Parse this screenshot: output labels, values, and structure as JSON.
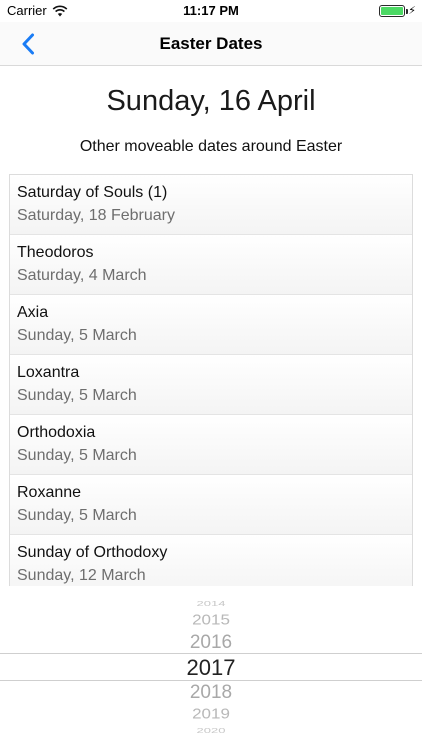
{
  "status_bar": {
    "carrier": "Carrier",
    "time": "11:17 PM"
  },
  "nav": {
    "title": "Easter Dates",
    "back_icon": "chevron-left-icon"
  },
  "header": {
    "easter_date": "Sunday, 16 April",
    "subtitle": "Other moveable dates around Easter"
  },
  "dates": [
    {
      "name": "Saturday of Souls (1)",
      "date": "Saturday, 18 February"
    },
    {
      "name": "Theodoros",
      "date": "Saturday, 4 March"
    },
    {
      "name": "Axia",
      "date": "Sunday, 5 March"
    },
    {
      "name": "Loxantra",
      "date": "Sunday, 5 March"
    },
    {
      "name": "Orthodoxia",
      "date": "Sunday, 5 March"
    },
    {
      "name": "Roxanne",
      "date": "Sunday, 5 March"
    },
    {
      "name": "Sunday of Orthodoxy",
      "date": "Sunday, 12 March"
    }
  ],
  "year_picker": {
    "years": [
      "2014",
      "2015",
      "2016",
      "2017",
      "2018",
      "2019",
      "2020"
    ],
    "selected": "2017"
  },
  "colors": {
    "accent": "#1a7cf5",
    "battery": "#4cd964"
  }
}
